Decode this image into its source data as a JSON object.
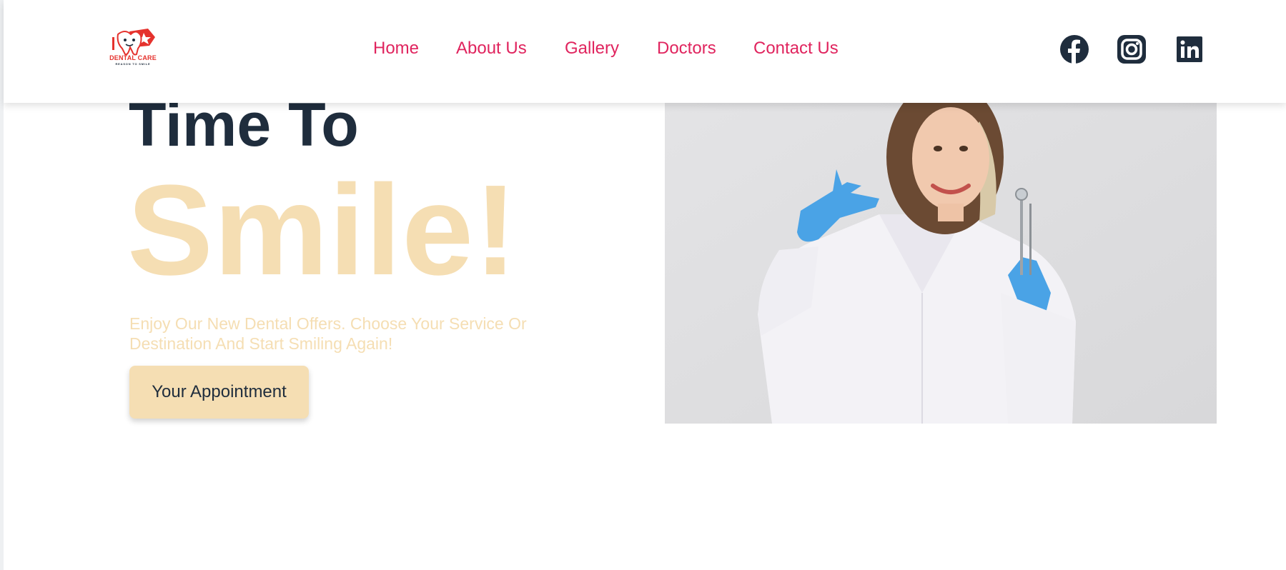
{
  "brand": {
    "name": "DENTAL CARE",
    "tagline": "REASON TO SMILE"
  },
  "nav": {
    "items": [
      "Home",
      "About Us",
      "Gallery",
      "Doctors",
      "Contact Us"
    ]
  },
  "social": {
    "icons": [
      "facebook-icon",
      "instagram-icon",
      "linkedin-icon"
    ]
  },
  "hero": {
    "title_line1": "Time To",
    "title_line2": "Smile!",
    "subtitle": "Enjoy Our New Dental Offers. Choose Your Service Or Destination And Start Smiling Again!",
    "cta_label": "Your Appointment"
  },
  "colors": {
    "nav_link": "#e0245e",
    "heading_dark": "#1f2d3d",
    "accent_wheat": "#f5deb3",
    "brand_red": "#e5322d"
  }
}
